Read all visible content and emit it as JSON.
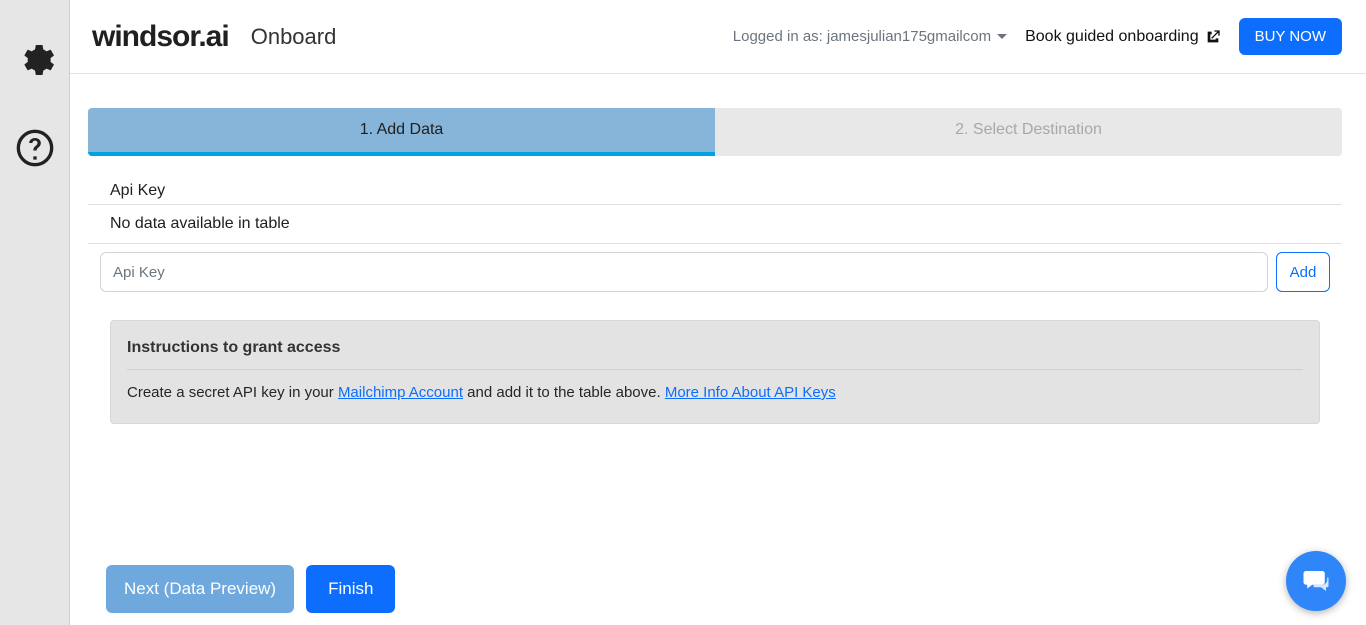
{
  "logo": "windsor.ai",
  "logo_sub": "Onboard",
  "header": {
    "logged_in_prefix": "Logged in as: ",
    "logged_in_user": "jamesjulian175gmailcom",
    "book_label": "Book guided onboarding",
    "buy_label": "BUY NOW"
  },
  "tabs": [
    {
      "label": "1. Add Data",
      "active": true
    },
    {
      "label": "2. Select Destination",
      "active": false
    }
  ],
  "table": {
    "header_label": "Api Key",
    "empty_label": "No data available in table"
  },
  "input": {
    "placeholder": "Api Key",
    "value": "",
    "add_label": "Add"
  },
  "instructions": {
    "title": "Instructions to grant access",
    "text_before": "Create a secret API key in your ",
    "link1_label": "Mailchimp Account",
    "text_middle": " and add it to the table above. ",
    "link2_label": "More Info About API Keys"
  },
  "footer": {
    "next_label": "Next (Data Preview)",
    "finish_label": "Finish"
  }
}
